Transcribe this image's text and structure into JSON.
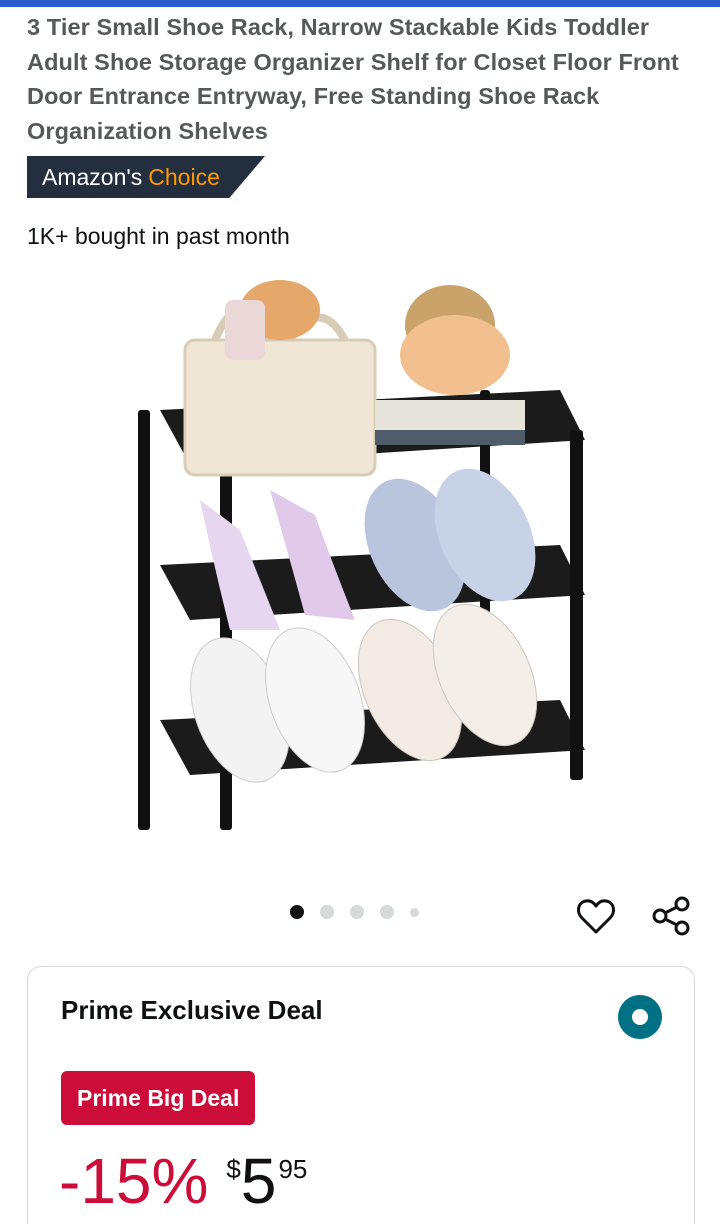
{
  "product": {
    "title": "3 Tier Small Shoe Rack, Narrow Stackable Kids Toddler Adult Shoe Storage Organizer Shelf for Closet Floor Front Door Entrance Entryway, Free Standing Shoe Rack Organization Shelves",
    "badge": {
      "prefix": "Amazon's",
      "accent": "Choice"
    },
    "social_proof": "1K+ bought in past month",
    "image_carousel": {
      "total": 5,
      "active_index": 0
    }
  },
  "actions": {
    "wishlist_icon": "heart-outline-icon",
    "share_icon": "share-icon"
  },
  "deal": {
    "title": "Prime Exclusive Deal",
    "badge": "Prime Big Deal",
    "discount": "-15%",
    "price": {
      "symbol": "$",
      "whole": "5",
      "fraction": "95"
    },
    "selected": true
  },
  "colors": {
    "brand_navy": "#232f3e",
    "accent_orange": "#ff9900",
    "deal_red": "#cc0c39",
    "teal": "#007185"
  }
}
